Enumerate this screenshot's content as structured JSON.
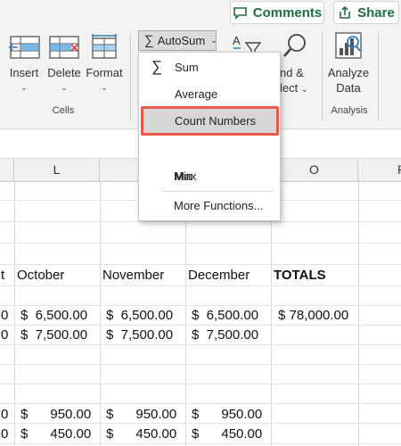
{
  "topbar": {
    "comments": "Comments",
    "share": "Share"
  },
  "ribbon": {
    "insert": "Insert",
    "delete": "Delete",
    "format": "Format",
    "cells_group": "Cells",
    "autosum": "AutoSum",
    "find_line1": "nd &",
    "find_line2": "lect",
    "analyze_line1": "Analyze",
    "analyze_line2": "Data",
    "analysis_group": "Analysis"
  },
  "menu": {
    "items": [
      "Sum",
      "Average",
      "Count Numbers",
      "Max",
      "Min",
      "More Functions..."
    ],
    "selected": "Count Numbers"
  },
  "columns": [
    "L",
    "O",
    "P"
  ],
  "grid": {
    "headers": [
      "October",
      "November",
      "December",
      "TOTALS"
    ],
    "r1": [
      "$  6,500.00",
      "$  6,500.00",
      "$  6,500.00",
      "$ 78,000.00"
    ],
    "r2": [
      "$  7,500.00",
      "$  7,500.00",
      "$  7,500.00"
    ],
    "r3": [
      "$      950.00",
      "$      950.00",
      "$      950.00"
    ],
    "r4": [
      "$      450.00",
      "$      450.00",
      "$      450.00"
    ],
    "left_frag": [
      "t",
      "0",
      "0",
      "0",
      "0"
    ]
  },
  "colors": {
    "accent_green": "#1f6e43",
    "highlight": "#e8594b"
  }
}
